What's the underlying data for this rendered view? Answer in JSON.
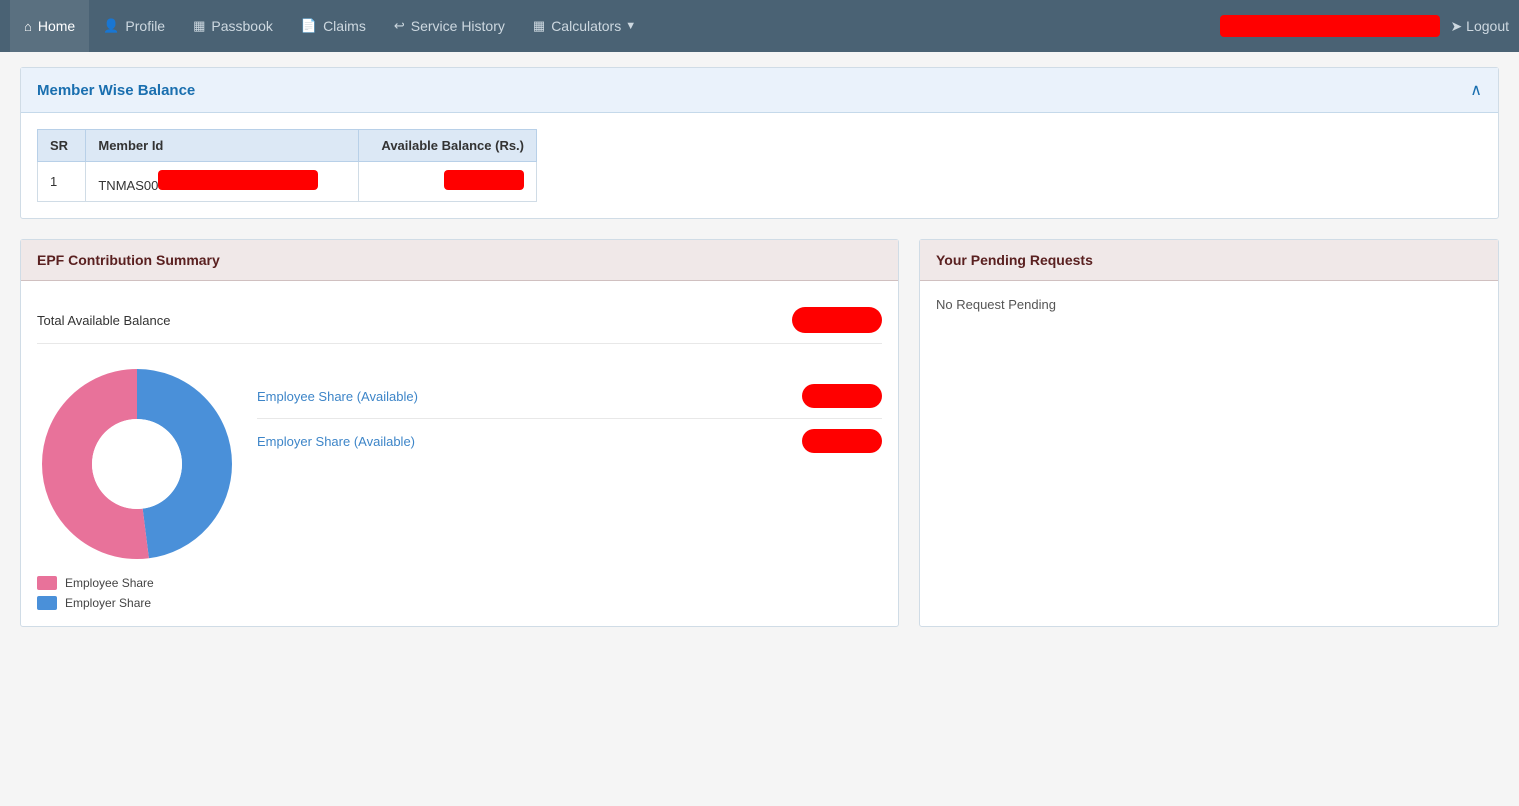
{
  "navbar": {
    "items": [
      {
        "id": "home",
        "label": "Home",
        "icon": "⌂",
        "active": true
      },
      {
        "id": "profile",
        "label": "Profile",
        "icon": "👤",
        "active": false
      },
      {
        "id": "passbook",
        "label": "Passbook",
        "icon": "📋",
        "active": false
      },
      {
        "id": "claims",
        "label": "Claims",
        "icon": "📄",
        "active": false
      },
      {
        "id": "service-history",
        "label": "Service History",
        "icon": "↩",
        "active": false
      },
      {
        "id": "calculators",
        "label": "Calculators",
        "icon": "📊",
        "active": false
      }
    ],
    "logout_label": "Logout"
  },
  "member_balance": {
    "title": "Member Wise Balance",
    "table": {
      "headers": [
        "SR",
        "Member Id",
        "Available Balance (Rs.)"
      ],
      "rows": [
        {
          "sr": "1",
          "member_id": "TNMAS00[REDACTED]",
          "balance": "[REDACTED]"
        }
      ]
    }
  },
  "epf_summary": {
    "title": "EPF Contribution Summary",
    "total_label": "Total Available Balance",
    "employee_label": "Employee Share (Available)",
    "employer_label": "Employer Share (Available)",
    "chart": {
      "employee_share_percent": 52,
      "employer_share_percent": 48,
      "employee_color": "#e8729a",
      "employer_color": "#4a90d9"
    },
    "legend": {
      "employee": "Employee Share",
      "employer": "Employer Share"
    }
  },
  "pending_requests": {
    "title": "Your Pending Requests",
    "message": "No Request Pending"
  }
}
